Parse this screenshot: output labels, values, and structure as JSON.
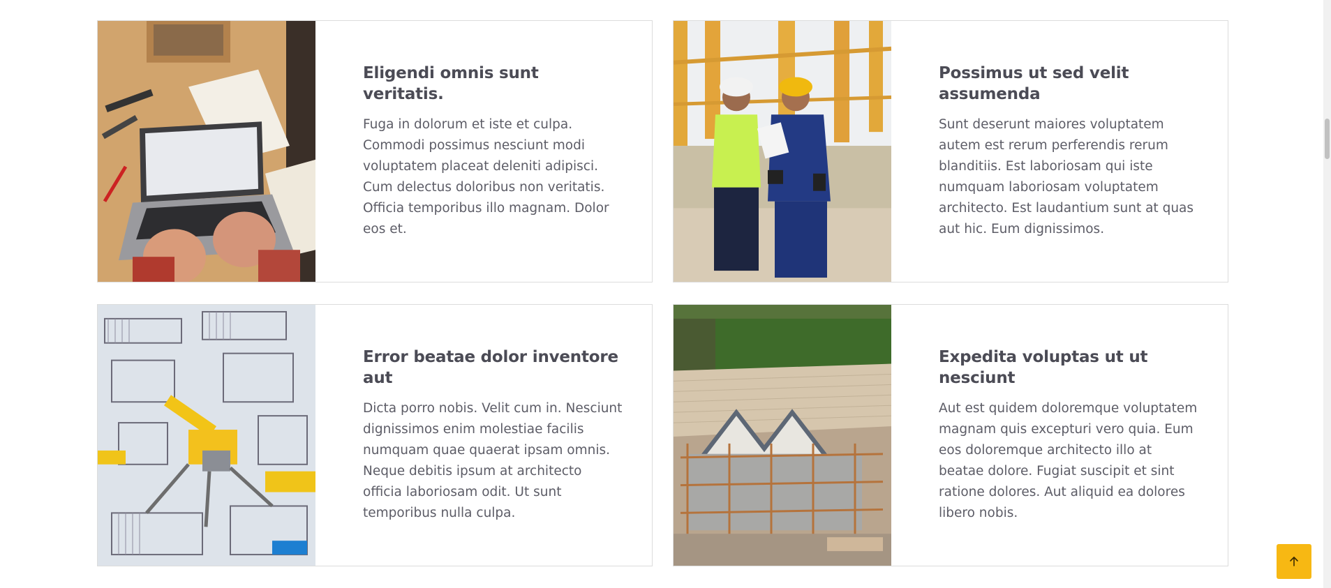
{
  "cards": [
    {
      "title": "Eligendi omnis sunt veritatis.",
      "text": "Fuga in dolorum et iste et culpa. Commodi possimus nesciunt modi voluptatem placeat deleniti adipisci. Cum delectus doloribus non veritatis. Officia temporibus illo magnam. Dolor eos et.",
      "image": "laptop-workbench-photo"
    },
    {
      "title": "Possimus ut sed velit assumenda",
      "text": "Sunt deserunt maiores voluptatem autem est rerum perferendis rerum blanditiis. Est laboriosam qui iste numquam laboriosam voluptatem architecto. Est laudantium sunt at quas aut hic. Eum dignissimos.",
      "image": "construction-workers-photo"
    },
    {
      "title": "Error beatae dolor inventore aut",
      "text": "Dicta porro nobis. Velit cum in. Nesciunt dignissimos enim molestiae facilis numquam quae quaerat ipsam omnis. Neque debitis ipsum at architecto officia laboriosam odit. Ut sunt temporibus nulla culpa.",
      "image": "construction-site-aerial-photo"
    },
    {
      "title": "Expedita voluptas ut ut nesciunt",
      "text": "Aut est quidem doloremque voluptatem magnam quis excepturi vero quia. Eum eos doloremque architecto illo at beatae dolore. Fugiat suscipit et sint ratione dolores. Aut aliquid ea dolores libero nobis.",
      "image": "house-scaffolding-photo"
    }
  ],
  "back_to_top": {
    "icon": "arrow-up-icon",
    "color": "#f7b813"
  },
  "colors": {
    "heading": "#4b4b55",
    "body_text": "#5c5c66",
    "card_border": "#dcdcdc",
    "accent": "#f7b813"
  }
}
